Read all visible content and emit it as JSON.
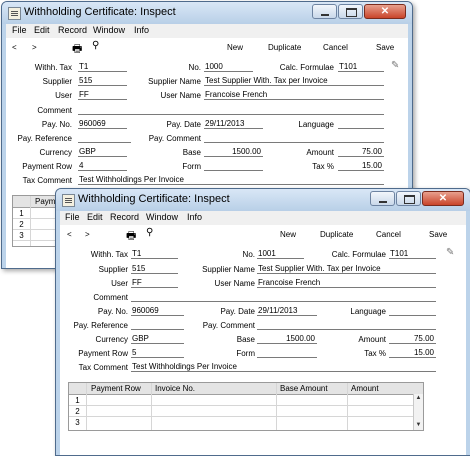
{
  "window_title": "Withholding Certificate: Inspect",
  "menu": [
    "File",
    "Edit",
    "Record",
    "Window",
    "Info"
  ],
  "toolbar": {
    "prev": "<",
    "next": ">",
    "new": "New",
    "duplicate": "Duplicate",
    "cancel": "Cancel",
    "save": "Save"
  },
  "labels": {
    "with_tax": "Withh. Tax",
    "no": "No.",
    "calc_formulae": "Calc. Formulae",
    "supplier": "Supplier",
    "supplier_name": "Supplier Name",
    "user": "User",
    "user_name": "User Name",
    "comment": "Comment",
    "pay_no": "Pay. No.",
    "pay_date": "Pay. Date",
    "language": "Language",
    "pay_reference": "Pay. Reference",
    "pay_comment": "Pay. Comment",
    "currency": "Currency",
    "base": "Base",
    "amount": "Amount",
    "payment_row": "Payment Row",
    "form": "Form",
    "tax_pct": "Tax %",
    "tax_comment": "Tax Comment"
  },
  "values": {
    "with_tax": "T1",
    "no": "1000",
    "calc_formulae": "T101",
    "supplier": "515",
    "supplier_name": "Test Supplier With. Tax per Invoice",
    "user": "FF",
    "user_name": "Francoise French",
    "comment": "",
    "pay_no": "960069",
    "pay_date": "29/11/2013",
    "language": "",
    "pay_reference": "",
    "pay_comment": "",
    "currency": "GBP",
    "base": "1500.00",
    "amount": "75.00",
    "payment_row": "4",
    "form": "",
    "tax_pct": "15.00",
    "tax_comment": "Test Withholdings Per Invoice"
  },
  "values_front": {
    "with_tax": "T1",
    "no": "1001",
    "calc_formulae": "T101",
    "supplier": "515",
    "supplier_name": "Test Supplier With. Tax per Invoice",
    "user": "FF",
    "user_name": "Francoise French",
    "comment": "",
    "pay_no": "960069",
    "pay_date": "29/11/2013",
    "language": "",
    "pay_reference": "",
    "pay_comment": "",
    "currency": "GBP",
    "base": "1500.00",
    "amount": "75.00",
    "payment_row": "5",
    "form": "",
    "tax_pct": "15.00",
    "tax_comment": "Test Withholdings Per Invoice"
  },
  "grid": {
    "back_columns": [
      "Payme"
    ],
    "columns": [
      "Payment Row",
      "Invoice No.",
      "Base Amount",
      "Amount"
    ],
    "rows": [
      "1",
      "2",
      "3"
    ]
  },
  "colors": {
    "window_frame": "#bcd3ea",
    "close_button": "#c9442a"
  },
  "icons": [
    "window-icon",
    "print-icon",
    "search-icon",
    "lock-icon",
    "minimize-icon",
    "maximize-icon",
    "close-icon"
  ]
}
